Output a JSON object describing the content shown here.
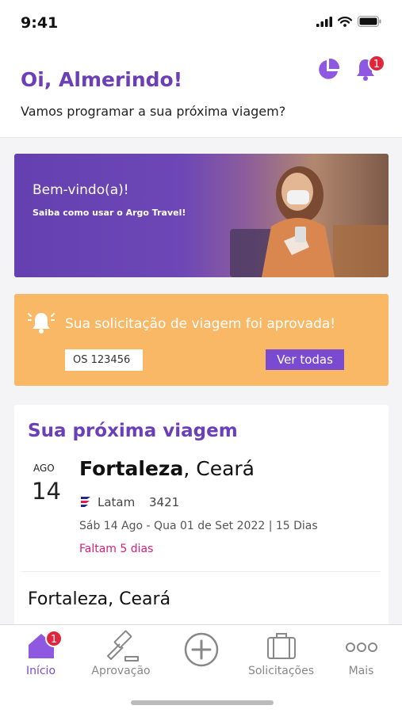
{
  "status_bar": {
    "time": "9:41"
  },
  "header": {
    "greeting": "Oi, Almerindo!",
    "subtitle": "Vamos programar a sua próxima viagem?",
    "notification_count": "1"
  },
  "banner": {
    "title": "Bem-vindo(a)!",
    "subtitle": "Saiba como usar o Argo Travel!"
  },
  "alert": {
    "message": "Sua solicitação de viagem foi aprovada!",
    "order": "OS 123456",
    "button_label": "Ver todas"
  },
  "next_trip": {
    "section_title": "Sua próxima viagem",
    "month": "AGO",
    "day": "14",
    "city": "Fortaleza",
    "state": ", Ceará",
    "airline": "Latam",
    "flight": "3421",
    "dates": "Sáb 14 Ago - Qua 01 de Set 2022  |  15 Dias",
    "remaining": "Faltam 5 dias",
    "second_city": "Fortaleza, Ceará"
  },
  "tabbar": {
    "items": [
      {
        "label": "Início",
        "icon": "home-icon",
        "badge": "1"
      },
      {
        "label": "Aprovação",
        "icon": "gavel-icon"
      },
      {
        "label": "",
        "icon": "plus-circle-icon"
      },
      {
        "label": "Solicitações",
        "icon": "briefcase-icon"
      },
      {
        "label": "Mais",
        "icon": "more-icon"
      }
    ]
  },
  "colors": {
    "primary": "#6a3fb8",
    "accent_button": "#7a4bd0",
    "alert_bg": "#f9b865",
    "badge": "#e0263a",
    "remaining_text": "#d61d7a"
  }
}
